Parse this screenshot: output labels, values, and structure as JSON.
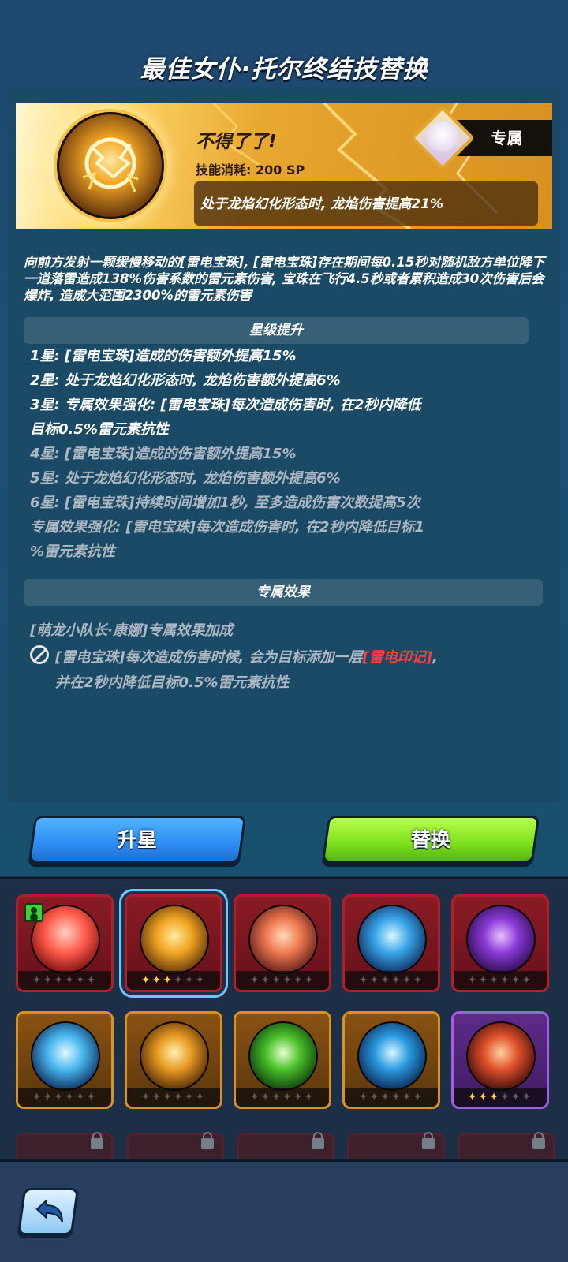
{
  "page_title": "最佳女仆·托尔终结技替换",
  "skill": {
    "name": "不得了了!",
    "cost": "技能消耗: 200 SP",
    "effect": "处于龙焰幻化形态时, 龙焰伤害提高21%",
    "exclusive_label": "专属",
    "description": "向前方发射一颗缓慢移动的[雷电宝珠], [雷电宝珠]存在期间每0.15秒对随机敌方单位降下一道落雷造成138%伤害系数的雷元素伤害, 宝珠在飞行4.5秒或者累积造成30次伤害后会爆炸, 造成大范围2300%的雷元素伤害"
  },
  "star_section": {
    "title": "星级提升",
    "lines": [
      "1星: [雷电宝珠]造成的伤害额外提高15%",
      "2星: 处于龙焰幻化形态时, 龙焰伤害额外提高6%",
      "3星: 专属效果强化: [雷电宝珠]每次造成伤害时, 在2秒内降低",
      "目标0.5%雷元素抗性",
      "4星: [雷电宝珠]造成的伤害额外提高15%",
      "5星: 处于龙焰幻化形态时, 龙焰伤害额外提高6%",
      "6星: [雷电宝珠]持续时间增加1秒, 至多造成伤害次数提高5次",
      "专属效果强化: [雷电宝珠]每次造成伤害时, 在2秒内降低目标1",
      "%雷元素抗性"
    ]
  },
  "exclusive_section": {
    "title": "专属效果",
    "source": "[萌龙小队长·康娜]专属效果加成",
    "text_part1": "[雷电宝珠]每次造成伤害时候, 会为目标添加一层",
    "text_highlight": "[雷电印记]",
    "text_part2": ",",
    "text_line2": "并在2秒内降低目标0.5%雷元素抗性"
  },
  "buttons": {
    "upgrade": "升星",
    "replace": "替换"
  },
  "skill_cards": [
    {
      "name": "mushroom-cloud-skill",
      "frame": "red",
      "stars": 0,
      "badge": true,
      "selected": false
    },
    {
      "name": "thunder-orb-skill",
      "frame": "red",
      "stars": 3,
      "badge": false,
      "selected": true
    },
    {
      "name": "fire-sphere-skill",
      "frame": "red",
      "stars": 0,
      "badge": false,
      "selected": false
    },
    {
      "name": "ice-crystal-skill",
      "frame": "red",
      "stars": 0,
      "badge": false,
      "selected": false
    },
    {
      "name": "dark-spike-skill",
      "frame": "red",
      "stars": 0,
      "badge": false,
      "selected": false
    },
    {
      "name": "ice-shards-skill",
      "frame": "gold",
      "stars": 0,
      "badge": false,
      "selected": false
    },
    {
      "name": "lightning-bolts-skill",
      "frame": "gold",
      "stars": 0,
      "badge": false,
      "selected": false
    },
    {
      "name": "green-arrow-skill",
      "frame": "gold",
      "stars": 0,
      "badge": false,
      "selected": false
    },
    {
      "name": "ice-fang-skill",
      "frame": "gold",
      "stars": 0,
      "badge": false,
      "selected": false
    },
    {
      "name": "fire-spirit-skill",
      "frame": "purple",
      "stars": 3,
      "badge": false,
      "selected": false
    }
  ],
  "colors": {
    "accent_blue": "#2f8ef4",
    "accent_green": "#7ee01e",
    "highlight_red": "#ff3b3b",
    "star_gold": "#ffd23a"
  }
}
